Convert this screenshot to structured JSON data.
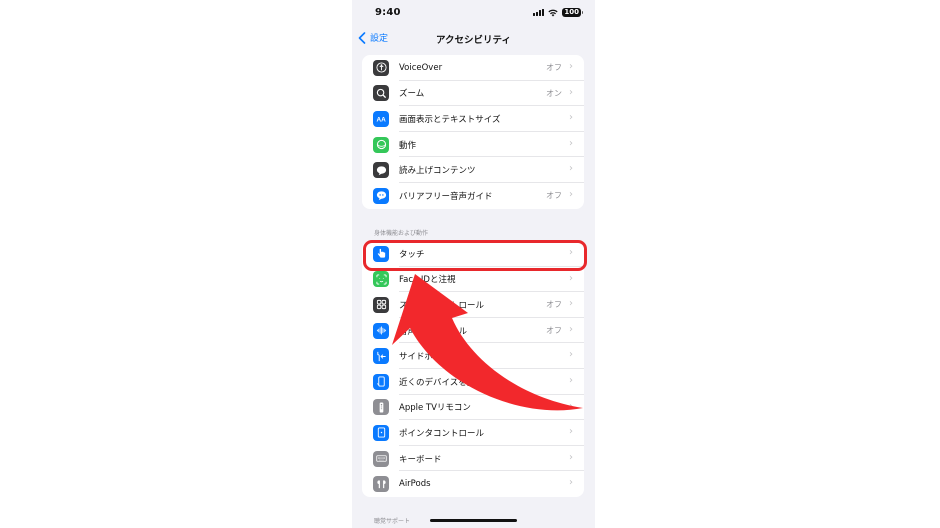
{
  "status_bar": {
    "time": "9:40",
    "battery": "100"
  },
  "nav": {
    "back_label": "設定",
    "title": "アクセシビリティ"
  },
  "vision_group": [
    {
      "label": "VoiceOver",
      "value": "オフ",
      "icon": "voiceover-icon",
      "color": "#3a3a3c"
    },
    {
      "label": "ズーム",
      "value": "オン",
      "icon": "zoom-icon",
      "color": "#3a3a3c"
    },
    {
      "label": "画面表示とテキストサイズ",
      "value": "",
      "icon": "text-size-icon",
      "color": "#0a7aff"
    },
    {
      "label": "動作",
      "value": "",
      "icon": "motion-icon",
      "color": "#34c759"
    },
    {
      "label": "読み上げコンテンツ",
      "value": "",
      "icon": "spoken-content-icon",
      "color": "#3a3a3c"
    },
    {
      "label": "バリアフリー音声ガイド",
      "value": "オフ",
      "icon": "audio-description-icon",
      "color": "#0a7aff"
    }
  ],
  "physical_section_header": "身体機能および動作",
  "physical_group": [
    {
      "label": "タッチ",
      "value": "",
      "icon": "touch-icon",
      "color": "#0a7aff"
    },
    {
      "label": "Face IDと注視",
      "value": "",
      "icon": "face-id-icon",
      "color": "#34c759"
    },
    {
      "label": "スイッチコントロール",
      "value": "オフ",
      "icon": "switch-control-icon",
      "color": "#3a3a3c"
    },
    {
      "label": "音声コントロール",
      "value": "オフ",
      "icon": "voice-control-icon",
      "color": "#0a7aff"
    },
    {
      "label": "サイドボタン",
      "value": "",
      "icon": "side-button-icon",
      "color": "#0a7aff"
    },
    {
      "label": "近くのデバイスを操作",
      "value": "",
      "icon": "nearby-devices-icon",
      "color": "#0a7aff"
    },
    {
      "label": "Apple TVリモコン",
      "value": "",
      "icon": "tv-remote-icon",
      "color": "#8e8e93"
    },
    {
      "label": "ポインタコントロール",
      "value": "",
      "icon": "pointer-control-icon",
      "color": "#0a7aff"
    },
    {
      "label": "キーボード",
      "value": "",
      "icon": "keyboard-icon",
      "color": "#8e8e93"
    },
    {
      "label": "AirPods",
      "value": "",
      "icon": "airpods-icon",
      "color": "#8e8e93"
    }
  ],
  "hearing_section_header": "聴覚サポート",
  "annotation": {
    "highlight_color": "#e8282c",
    "arrow_color": "#f2282c"
  }
}
